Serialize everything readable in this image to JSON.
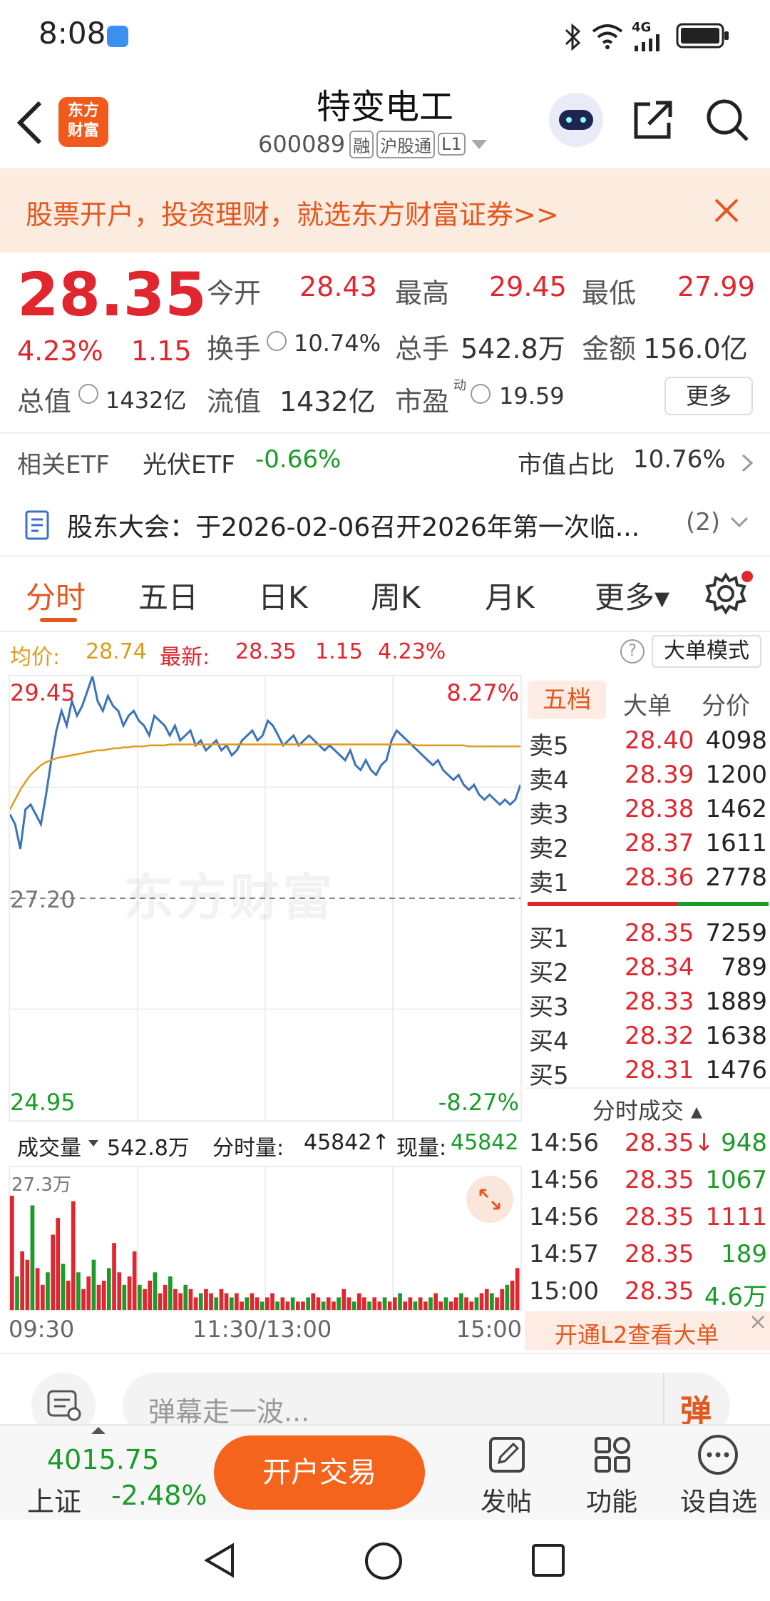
{
  "status_bar": {
    "time": "8:08",
    "network": "4G"
  },
  "header": {
    "title": "特变电工",
    "code": "600089",
    "tags": [
      "融",
      "沪股通",
      "L1"
    ],
    "logo_line1": "东方",
    "logo_line2": "财富"
  },
  "banner": {
    "text": "股票开户，投资理财，就选东方财富证券>>"
  },
  "quote": {
    "price": "28.35",
    "pct": "4.23%",
    "change": "1.15",
    "open_label": "今开",
    "open": "28.43",
    "high_label": "最高",
    "high": "29.45",
    "low_label": "最低",
    "low": "27.99",
    "turnover_label": "换手",
    "turnover": "10.74%",
    "volume_label": "总手",
    "volume": "542.8万",
    "amount_label": "金额",
    "amount": "156.0亿",
    "mktcap_label": "总值",
    "mktcap": "1432亿",
    "float_label": "流值",
    "float": "1432亿",
    "pe_label": "市盈",
    "pe_sup": "动",
    "pe": "19.59",
    "more_button": "更多"
  },
  "etf": {
    "label": "相关ETF",
    "name": "光伏ETF",
    "pct": "-0.66%",
    "share_label": "市值占比",
    "share": "10.76%"
  },
  "notice": {
    "text": "股东大会：于2026-02-06召开2026年第一次临...",
    "count": "(2)"
  },
  "tabs": [
    {
      "label": "分时",
      "active": true
    },
    {
      "label": "五日",
      "active": false
    },
    {
      "label": "日K",
      "active": false
    },
    {
      "label": "周K",
      "active": false
    },
    {
      "label": "月K",
      "active": false
    },
    {
      "label": "更多▾",
      "active": false
    }
  ],
  "chart_info": {
    "avg_label": "均价:",
    "avg": "28.74",
    "latest_label": "最新:",
    "latest": "28.35",
    "change": "1.15",
    "pct": "4.23%",
    "mode_button": "大单模式"
  },
  "chart_data": {
    "type": "line",
    "ylim": [
      24.95,
      29.45
    ],
    "y_labels": {
      "top": "29.45",
      "mid": "27.20",
      "bottom": "24.95"
    },
    "pct_labels": {
      "top": "8.27%",
      "bottom": "-8.27%"
    },
    "watermark": "东方财富",
    "series": [
      {
        "values": [
          28.05,
          27.95,
          27.7,
          28.1,
          28.15,
          28.05,
          27.95,
          28.25,
          28.6,
          28.9,
          29.1,
          28.95,
          29.2,
          29.05,
          29.15,
          29.3,
          29.45,
          29.2,
          29.1,
          29.25,
          29.15,
          29.1,
          28.95,
          29.05,
          29.1,
          29.0,
          28.95,
          28.85,
          29.05,
          29.0,
          28.95,
          28.85,
          28.95,
          28.8,
          28.85,
          28.9,
          28.75,
          28.8,
          28.7,
          28.75,
          28.8,
          28.7,
          28.75,
          28.65,
          28.7,
          28.8,
          28.85,
          28.9,
          28.8,
          28.85,
          29.0,
          28.95,
          28.85,
          28.75,
          28.8,
          28.85,
          28.75,
          28.8,
          28.85,
          28.8,
          28.75,
          28.7,
          28.75,
          28.7,
          28.65,
          28.6,
          28.7,
          28.55,
          28.5,
          28.6,
          28.5,
          28.45,
          28.55,
          28.6,
          28.8,
          28.9,
          28.85,
          28.8,
          28.75,
          28.7,
          28.65,
          28.6,
          28.55,
          28.6,
          28.5,
          28.45,
          28.4,
          28.45,
          28.35,
          28.3,
          28.35,
          28.25,
          28.2,
          28.25,
          28.2,
          28.15,
          28.2,
          28.15,
          28.2,
          28.35
        ]
      },
      {
        "values": [
          28.1,
          28.2,
          28.3,
          28.38,
          28.45,
          28.5,
          28.55,
          28.58,
          28.6,
          28.62,
          28.63,
          28.64,
          28.65,
          28.66,
          28.67,
          28.68,
          28.69,
          28.7,
          28.7,
          28.71,
          28.72,
          28.72,
          28.73,
          28.73,
          28.74,
          28.74,
          28.74,
          28.75,
          28.75,
          28.75,
          28.75,
          28.76,
          28.76,
          28.76,
          28.76,
          28.76,
          28.76,
          28.76,
          28.76,
          28.76,
          28.76,
          28.76,
          28.76,
          28.76,
          28.76,
          28.76,
          28.76,
          28.76,
          28.76,
          28.76,
          28.76,
          28.76,
          28.76,
          28.76,
          28.76,
          28.76,
          28.76,
          28.76,
          28.76,
          28.76,
          28.76,
          28.76,
          28.76,
          28.76,
          28.76,
          28.76,
          28.76,
          28.76,
          28.76,
          28.76,
          28.76,
          28.76,
          28.76,
          28.76,
          28.76,
          28.76,
          28.76,
          28.76,
          28.76,
          28.75,
          28.75,
          28.75,
          28.75,
          28.75,
          28.75,
          28.75,
          28.75,
          28.75,
          28.75,
          28.74,
          28.74,
          28.74,
          28.74,
          28.74,
          28.74,
          28.74,
          28.74,
          28.74,
          28.74,
          28.74
        ]
      }
    ],
    "volume": {
      "max_label": "27.3万",
      "label": "成交量",
      "total": "542.8万",
      "minute_label": "分时量:",
      "minute": "45842↑",
      "now_label": "现量:",
      "now": "45842",
      "bars": [
        27.3,
        8,
        14,
        12,
        25,
        10,
        6,
        9,
        18,
        22,
        11,
        7,
        26,
        9,
        5,
        8,
        12,
        6,
        7,
        10,
        16,
        9,
        6,
        8,
        14,
        6,
        5,
        7,
        9,
        4,
        6,
        8,
        5,
        4,
        6,
        5,
        3,
        4,
        5,
        4,
        3,
        5,
        4,
        3,
        4,
        2,
        3,
        4,
        3,
        2,
        3,
        4,
        2,
        3,
        2,
        3,
        2,
        2,
        3,
        4,
        3,
        2,
        3,
        2,
        3,
        5,
        3,
        2,
        4,
        3,
        2,
        3,
        2,
        3,
        2,
        3,
        4,
        2,
        3,
        2,
        3,
        2,
        3,
        4,
        2,
        3,
        2,
        3,
        4,
        3,
        2,
        3,
        4,
        5,
        4,
        3,
        5,
        6,
        7,
        10
      ]
    },
    "xlabels": [
      "09:30",
      "11:30/13:00",
      "15:00"
    ]
  },
  "orderbook": {
    "tabs": [
      "五档",
      "大单",
      "分价"
    ],
    "sells": [
      {
        "label": "卖5",
        "price": "28.40",
        "vol": "4098"
      },
      {
        "label": "卖4",
        "price": "28.39",
        "vol": "1200"
      },
      {
        "label": "卖3",
        "price": "28.38",
        "vol": "1462"
      },
      {
        "label": "卖2",
        "price": "28.37",
        "vol": "1611"
      },
      {
        "label": "卖1",
        "price": "28.36",
        "vol": "2778"
      }
    ],
    "buys": [
      {
        "label": "买1",
        "price": "28.35",
        "vol": "7259"
      },
      {
        "label": "买2",
        "price": "28.34",
        "vol": "789"
      },
      {
        "label": "买3",
        "price": "28.33",
        "vol": "1889"
      },
      {
        "label": "买4",
        "price": "28.32",
        "vol": "1638"
      },
      {
        "label": "买5",
        "price": "28.31",
        "vol": "1476"
      }
    ],
    "ticks_title": "分时成交 ▴",
    "ticks": [
      {
        "time": "14:56",
        "price": "28.35↓",
        "vol": "948"
      },
      {
        "time": "14:56",
        "price": "28.35",
        "vol": "1067"
      },
      {
        "time": "14:56",
        "price": "28.35",
        "vol": "1111"
      },
      {
        "time": "14:57",
        "price": "28.35",
        "vol": "189"
      },
      {
        "time": "15:00",
        "price": "28.35",
        "vol": "4.6万"
      }
    ],
    "l2_text": "开通L2查看大单"
  },
  "comment": {
    "placeholder": "弹幕走一波...",
    "danmu": "弹"
  },
  "bottom": {
    "index_value": "4015.75",
    "index_name": "上证",
    "index_pct": "-2.48%",
    "trade_button": "开户交易",
    "post": "发帖",
    "func": "功能",
    "watch": "设自选"
  }
}
